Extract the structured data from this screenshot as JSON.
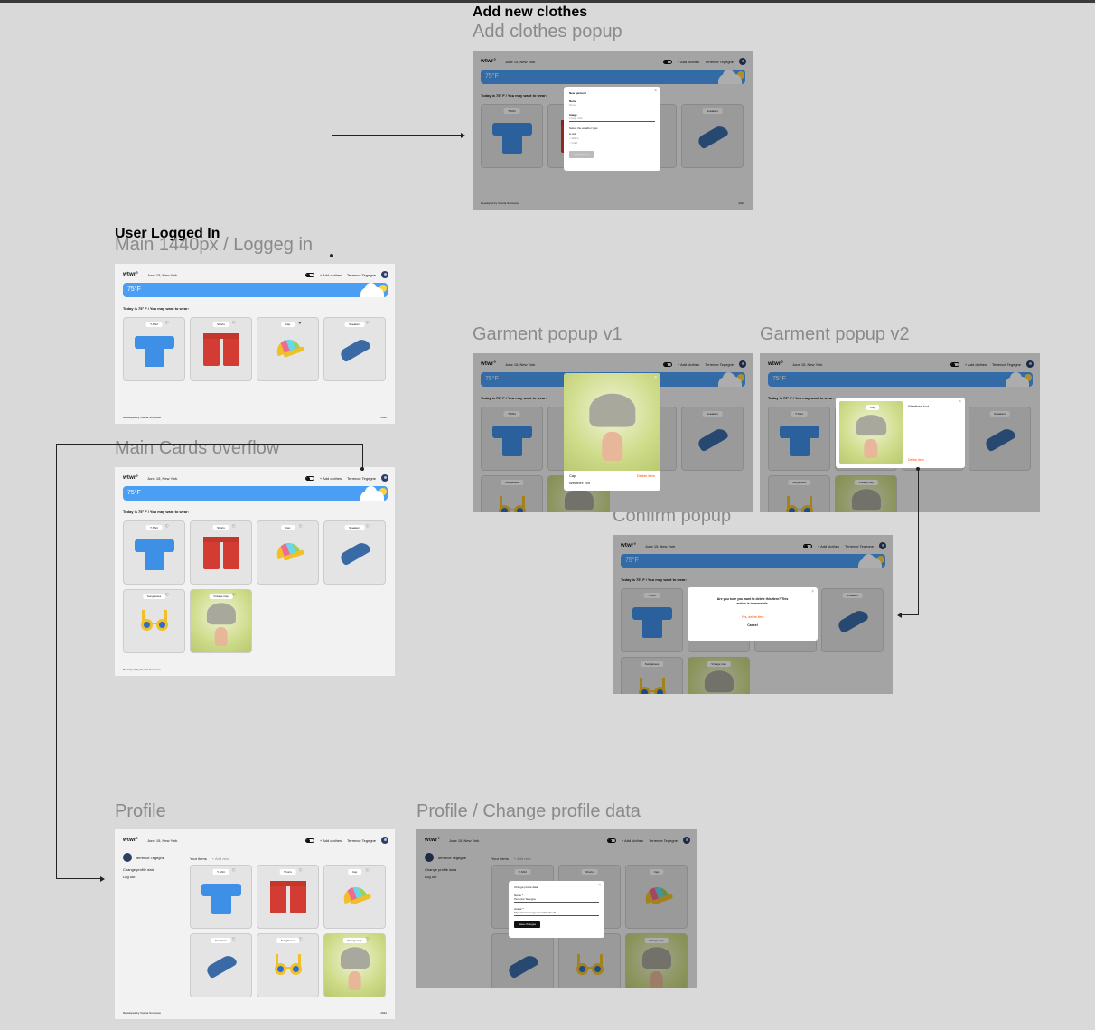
{
  "sections": {
    "add_new": "Add new clothes",
    "logged_in": "User Logged In"
  },
  "frames": {
    "add_clothes": "Add clothes popup",
    "main": "Main 1440px / Loggeg in",
    "overflow": "Main Cards overflow",
    "garment_v1": "Garment popup v1",
    "garment_v2": "Garment popup v2",
    "confirm": "Confirm popup",
    "profile": "Profile",
    "profile_change": "Profile / Change profile data"
  },
  "app": {
    "logo": "wtwr°",
    "date": "June 15, New York",
    "add_clothes": "+ Add clothes",
    "user": "Terrence Tegegne",
    "temp": "75°F",
    "today": "Today is 75° F / You may want to wear:",
    "footer_left": "Developed by Vsenia Sumsova",
    "footer_right": "2022"
  },
  "items": {
    "tshirt": "T-Shirt",
    "shorts": "Shorts",
    "cap": "Cap",
    "sneakers": "Sneakers",
    "sunglasses": "Sunglasses",
    "vintage_cap": "Vintage Cap"
  },
  "add_modal": {
    "title": "New garment",
    "name_label": "Name",
    "name_placeholder": "Name",
    "image_label": "Image",
    "image_placeholder": "Image URL",
    "weather_label": "Select the weather type:",
    "opt_hot": "Hot",
    "opt_warm": "Warm",
    "opt_cold": "Cold",
    "submit": "Add garment"
  },
  "garment_modal": {
    "name": "Cap",
    "weather": "Weather: hot",
    "delete": "Delete item"
  },
  "confirm_modal": {
    "question": "Are you sure you want to delete this item? This action is irreversible.",
    "yes": "Yes, delete item",
    "cancel": "Cancel"
  },
  "profile": {
    "change_data": "Change profile data",
    "logout": "Log out",
    "your_items": "Your items",
    "add_new": "+ Add new"
  },
  "change_modal": {
    "title": "Change profile data",
    "name_label": "Name *",
    "name_value": "Terrence Tegegne",
    "avatar_label": "Avatar *",
    "avatar_value": "https://www.images.com/tirnsfree8",
    "save": "Save changes"
  }
}
